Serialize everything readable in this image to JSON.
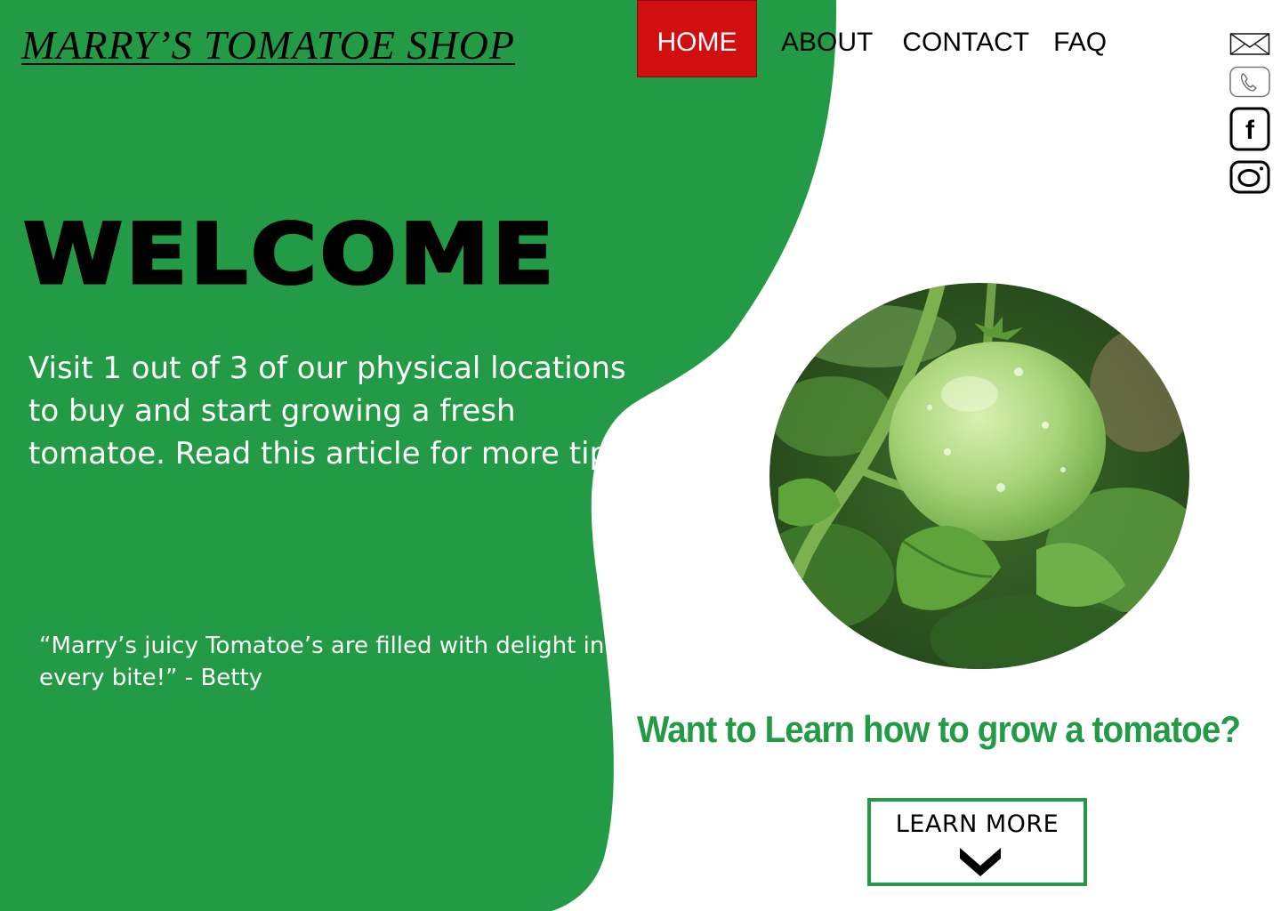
{
  "header": {
    "logo_text": "MARRY’S TOMATOE SHOP"
  },
  "nav": {
    "items": [
      {
        "label": "HOME",
        "active": true
      },
      {
        "label": "ABOUT",
        "active": false
      },
      {
        "label": "CONTACT",
        "active": false
      },
      {
        "label": "FAQ",
        "active": false
      }
    ]
  },
  "social": {
    "icons": [
      "mail-icon",
      "phone-icon",
      "facebook-icon",
      "instagram-icon"
    ],
    "facebook_glyph": "f"
  },
  "hero": {
    "title": "WELCOME",
    "intro": "Visit 1 out of 3 of our physical locations to buy and start growing a fresh tomatoe. Read this article for more tips.",
    "quote": "“Marry’s  juicy Tomatoe’s are filled with delight in every bite!” - Betty"
  },
  "cta": {
    "heading": "Want to Learn how to grow a tomatoe?",
    "button_label": "LEARN MORE",
    "button_icon": "chevron-down-icon"
  },
  "colors": {
    "brand_green": "#229a46",
    "active_red": "#d10f10",
    "text_dark": "#000000",
    "background": "#ffffff"
  }
}
